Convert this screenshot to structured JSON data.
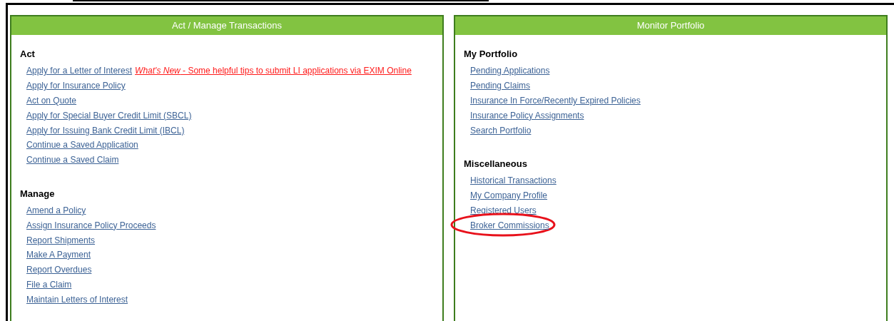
{
  "panels": [
    {
      "title": "Act / Manage Transactions",
      "sections": [
        {
          "heading": "Act",
          "links": [
            {
              "label": "Apply for a Letter of Interest",
              "note": "*What's New* - Some helpful tips to submit LI applications via EXIM Online",
              "circled": false
            },
            {
              "label": "Apply for Insurance Policy",
              "circled": false
            },
            {
              "label": "Act on Quote",
              "circled": false
            },
            {
              "label": "Apply for Special Buyer Credit Limit (SBCL)",
              "circled": false
            },
            {
              "label": "Apply for Issuing Bank Credit Limit (IBCL)",
              "circled": false
            },
            {
              "label": "Continue a Saved Application",
              "circled": false
            },
            {
              "label": "Continue a Saved Claim",
              "circled": false
            }
          ]
        },
        {
          "heading": "Manage",
          "links": [
            {
              "label": "Amend a Policy",
              "circled": false
            },
            {
              "label": "Assign Insurance Policy Proceeds",
              "circled": false
            },
            {
              "label": "Report Shipments",
              "circled": false
            },
            {
              "label": "Make A Payment",
              "circled": false
            },
            {
              "label": "Report Overdues",
              "circled": false
            },
            {
              "label": "File a Claim",
              "circled": false
            },
            {
              "label": "Maintain Letters of Interest",
              "circled": false
            }
          ]
        }
      ]
    },
    {
      "title": "Monitor Portfolio",
      "sections": [
        {
          "heading": "My Portfolio",
          "links": [
            {
              "label": "Pending Applications",
              "circled": false
            },
            {
              "label": "Pending Claims",
              "circled": false
            },
            {
              "label": "Insurance In Force/Recently Expired Policies",
              "circled": false
            },
            {
              "label": "Insurance Policy Assignments",
              "circled": false
            },
            {
              "label": "Search Portfolio",
              "circled": false
            }
          ]
        },
        {
          "heading": "Miscellaneous",
          "links": [
            {
              "label": "Historical Transactions",
              "circled": false
            },
            {
              "label": "My Company Profile",
              "circled": false
            },
            {
              "label": "Registered Users",
              "circled": false
            },
            {
              "label": "Broker Commissions",
              "circled": true
            }
          ]
        }
      ]
    }
  ]
}
